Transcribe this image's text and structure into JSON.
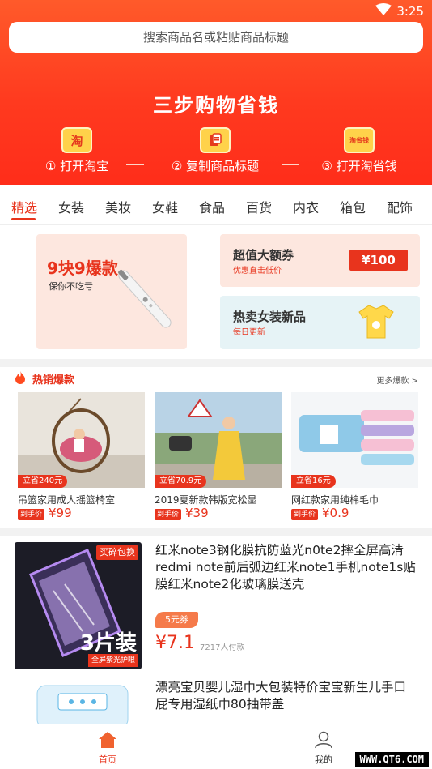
{
  "status": {
    "time": "3:25"
  },
  "search": {
    "placeholder": "搜索商品名或粘贴商品标题"
  },
  "hero": {
    "slogan": "三步购物省钱",
    "steps": [
      {
        "icon": "淘",
        "label": "① 打开淘宝"
      },
      {
        "icon": "copy-doc-icon",
        "label": "② 复制商品标题"
      },
      {
        "icon": "淘省钱",
        "label": "③ 打开淘省钱"
      }
    ]
  },
  "tabs": [
    "精选",
    "女装",
    "美妆",
    "女鞋",
    "食品",
    "百货",
    "内衣",
    "箱包",
    "配饰"
  ],
  "promo": {
    "left": {
      "title": "9块9爆款",
      "subtitle": "保你不吃亏"
    },
    "right1": {
      "title": "超值大额券",
      "subtitle": "优惠直击低价",
      "coupon": "¥100"
    },
    "right2": {
      "title": "热卖女装新品",
      "subtitle": "每日更新"
    }
  },
  "hot": {
    "title": "热销爆款",
    "more": "更多爆款 >",
    "items": [
      {
        "badge": "立省240元",
        "name": "吊篮家用成人摇篮椅室",
        "tag": "到手价",
        "price": "¥99"
      },
      {
        "badge": "立省70.9元",
        "name": "2019夏新款韩版宽松显",
        "tag": "到手价",
        "price": "¥39"
      },
      {
        "badge": "立省16元",
        "name": "网红款家用纯棉毛巾",
        "tag": "到手价",
        "price": "¥0.9"
      }
    ]
  },
  "products": [
    {
      "title": "红米note3钢化膜抗防蓝光n0te2摔全屏高清redmi note前后弧边红米note1手机note1s贴膜红米note2化玻璃膜送壳",
      "img_badge": "买碎包换",
      "img_big": "3片装",
      "img_small": "全屏紫光护眼",
      "coupon": "5元券",
      "price": "¥7.1",
      "sold": "7217人付款"
    },
    {
      "title": "漂亮宝贝婴儿湿巾大包装特价宝宝新生儿手口屁专用湿纸巾80抽带盖"
    }
  ],
  "bottom_nav": [
    {
      "label": "首页",
      "active": true
    },
    {
      "label": "我的",
      "active": false
    }
  ],
  "watermark": "WWW.QT6.COM",
  "colors": {
    "accent": "#e8341d",
    "hero": "#ff3a1f"
  }
}
